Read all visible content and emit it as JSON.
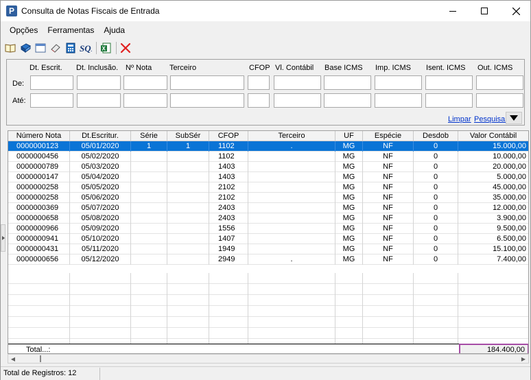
{
  "window": {
    "title": "Consulta de Notas Fiscais de Entrada"
  },
  "menu": {
    "items": [
      "Opções",
      "Ferramentas",
      "Ajuda"
    ]
  },
  "toolbar": {
    "icons": [
      "open-book-icon",
      "blue-book-icon",
      "window-icon",
      "eraser-icon",
      "calculator-icon",
      "sql-icon",
      "excel-export-icon",
      "delete-x-icon"
    ],
    "delete_color": "#e02020"
  },
  "filters": {
    "columns": [
      "Dt. Escrit.",
      "Dt. Inclusão.",
      "Nº Nota",
      "Terceiro",
      "CFOP",
      "Vl. Contábil",
      "Base ICMS",
      "Imp. ICMS",
      "Isent. ICMS",
      "Out. ICMS"
    ],
    "row_from": "De:",
    "row_to": "Até:",
    "limpar": "Limpar",
    "pesquisar": "Pesquisar"
  },
  "grid": {
    "headers": [
      "Número Nota",
      "Dt.Escritur.",
      "Série",
      "SubSér",
      "CFOP",
      "Terceiro",
      "UF",
      "Espécie",
      "Desdob",
      "Valor Contábil"
    ],
    "rows": [
      {
        "numero": "0000000123",
        "data": "05/01/2020",
        "serie": "1",
        "subserie": "1",
        "cfop": "1102",
        "terceiro": ".",
        "uf": "MG",
        "especie": "NF",
        "desdob": "0",
        "valor": "15.000,00"
      },
      {
        "numero": "0000000456",
        "data": "05/02/2020",
        "serie": "",
        "subserie": "",
        "cfop": "1102",
        "terceiro": "",
        "uf": "MG",
        "especie": "NF",
        "desdob": "0",
        "valor": "10.000,00"
      },
      {
        "numero": "0000000789",
        "data": "05/03/2020",
        "serie": "",
        "subserie": "",
        "cfop": "1403",
        "terceiro": "",
        "uf": "MG",
        "especie": "NF",
        "desdob": "0",
        "valor": "20.000,00"
      },
      {
        "numero": "0000000147",
        "data": "05/04/2020",
        "serie": "",
        "subserie": "",
        "cfop": "1403",
        "terceiro": "",
        "uf": "MG",
        "especie": "NF",
        "desdob": "0",
        "valor": "5.000,00"
      },
      {
        "numero": "0000000258",
        "data": "05/05/2020",
        "serie": "",
        "subserie": "",
        "cfop": "2102",
        "terceiro": "",
        "uf": "MG",
        "especie": "NF",
        "desdob": "0",
        "valor": "45.000,00"
      },
      {
        "numero": "0000000258",
        "data": "05/06/2020",
        "serie": "",
        "subserie": "",
        "cfop": "2102",
        "terceiro": "",
        "uf": "MG",
        "especie": "NF",
        "desdob": "0",
        "valor": "35.000,00"
      },
      {
        "numero": "0000000369",
        "data": "05/07/2020",
        "serie": "",
        "subserie": "",
        "cfop": "2403",
        "terceiro": "",
        "uf": "MG",
        "especie": "NF",
        "desdob": "0",
        "valor": "12.000,00"
      },
      {
        "numero": "0000000658",
        "data": "05/08/2020",
        "serie": "",
        "subserie": "",
        "cfop": "2403",
        "terceiro": "",
        "uf": "MG",
        "especie": "NF",
        "desdob": "0",
        "valor": "3.900,00"
      },
      {
        "numero": "0000000966",
        "data": "05/09/2020",
        "serie": "",
        "subserie": "",
        "cfop": "1556",
        "terceiro": "",
        "uf": "MG",
        "especie": "NF",
        "desdob": "0",
        "valor": "9.500,00"
      },
      {
        "numero": "0000000941",
        "data": "05/10/2020",
        "serie": "",
        "subserie": "",
        "cfop": "1407",
        "terceiro": "",
        "uf": "MG",
        "especie": "NF",
        "desdob": "0",
        "valor": "6.500,00"
      },
      {
        "numero": "0000000431",
        "data": "05/11/2020",
        "serie": "",
        "subserie": "",
        "cfop": "1949",
        "terceiro": "",
        "uf": "MG",
        "especie": "NF",
        "desdob": "0",
        "valor": "15.100,00"
      },
      {
        "numero": "0000000656",
        "data": "05/12/2020",
        "serie": "",
        "subserie": "",
        "cfop": "2949",
        "terceiro": ".",
        "uf": "MG",
        "especie": "NF",
        "desdob": "0",
        "valor": "7.400,00"
      }
    ],
    "selected_row": 0,
    "selection_color": "#0a74d6",
    "total_label": "Total...:",
    "total_value": "184.400,00",
    "total_highlight_color": "#a64ca6"
  },
  "status": {
    "text": "Total de Registros: 12"
  }
}
